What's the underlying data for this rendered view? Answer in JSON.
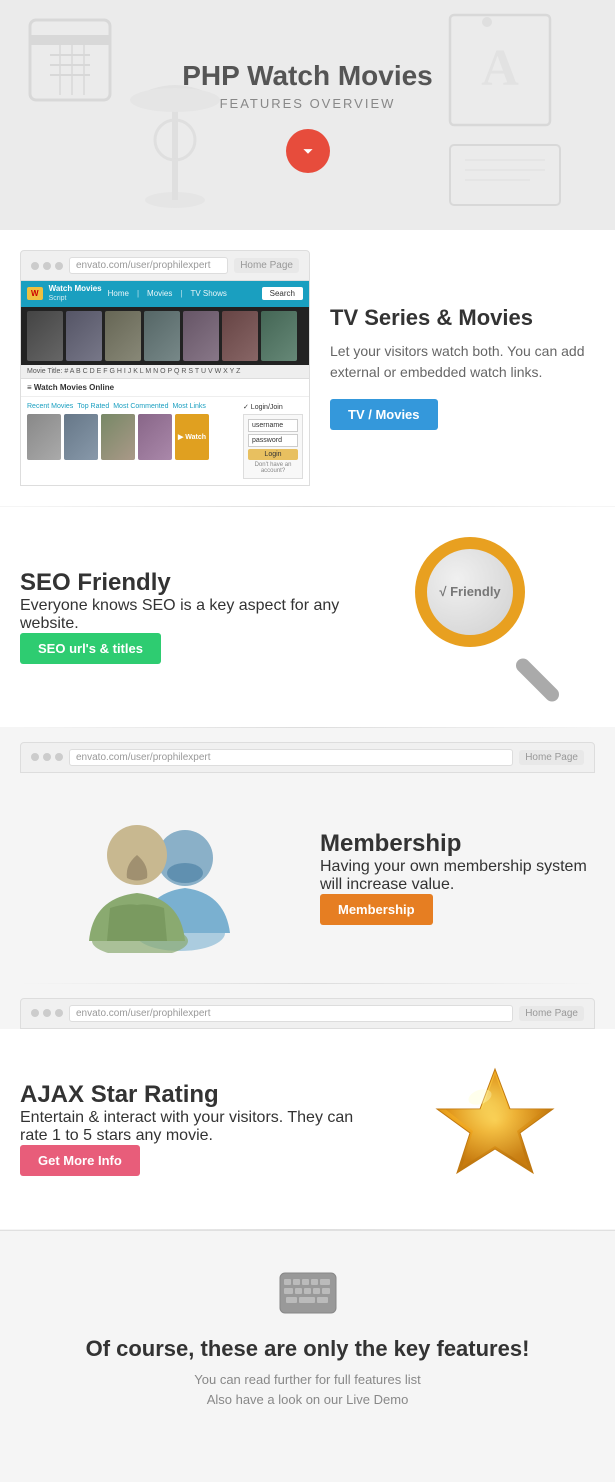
{
  "hero": {
    "title": "PHP Watch Movies",
    "subtitle": "FEATURES OVERVIEW",
    "scroll_btn": "scroll-down"
  },
  "section_tv": {
    "heading": "TV Series & Movies",
    "description": "Let your visitors watch both. You can add external or embedded watch links.",
    "btn_label": "TV / Movies",
    "btn_class": "btn-blue"
  },
  "section_seo": {
    "heading": "SEO Friendly",
    "description": "Everyone knows SEO is a key aspect for any website.",
    "btn_label": "SEO url's & titles",
    "btn_class": "btn-green"
  },
  "section_membership": {
    "heading": "Membership",
    "description": "Having your own membership system will increase value.",
    "btn_label": "Membership",
    "btn_class": "btn-orange"
  },
  "section_ajax": {
    "heading": "AJAX Star Rating",
    "description": "Entertain & interact with your visitors. They can rate 1 to 5 stars any movie.",
    "btn_label": "Get More Info",
    "btn_class": "btn-pink"
  },
  "footer": {
    "heading": "Of course, these are only the key features!",
    "line1": "You can read further for full features list",
    "line2": "Also have a look on our Live Demo"
  },
  "browser": {
    "url": "envato.com/user/prophilexpert",
    "next": "Home Page"
  }
}
